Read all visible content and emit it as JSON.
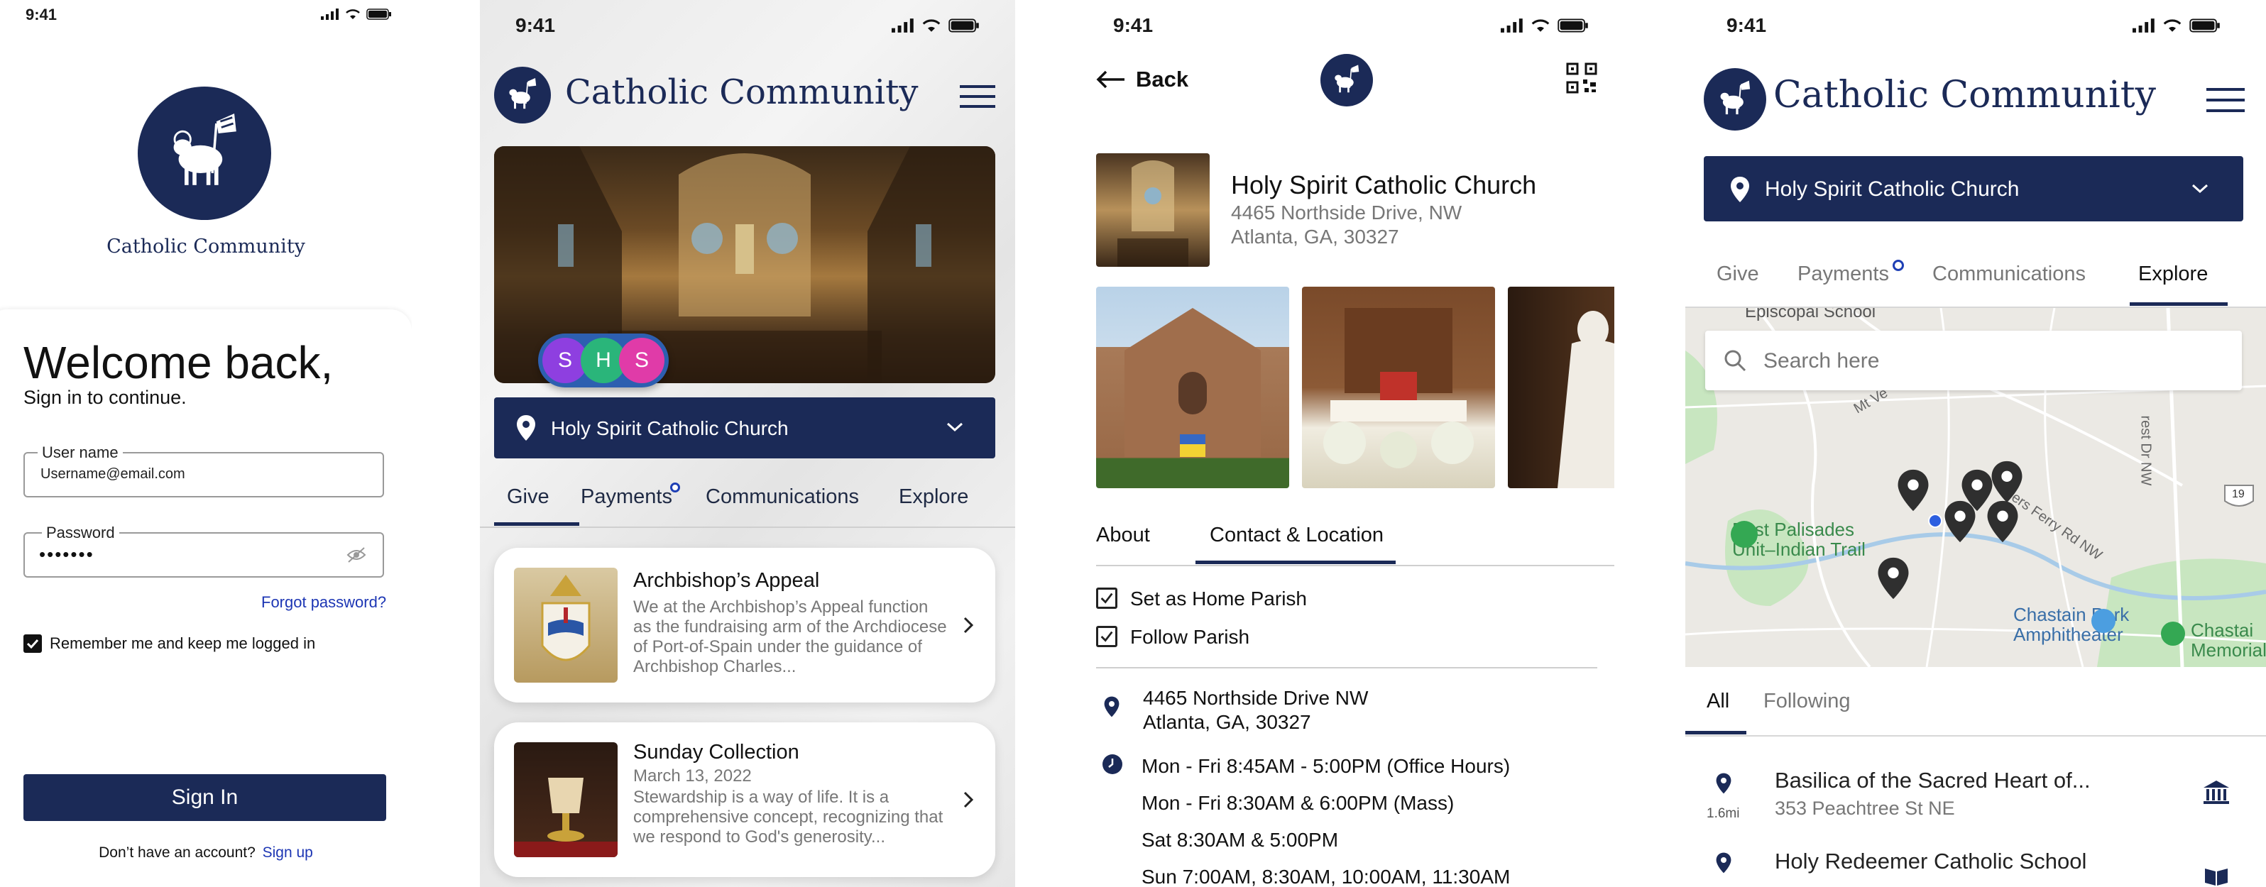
{
  "colors": {
    "navy": "#1b2a57",
    "accent_blue": "#1e3fb5",
    "link": "#1d36b4",
    "notification_dot": "#1e3fb5"
  },
  "status": {
    "time": "9:41"
  },
  "login": {
    "app_name": "Catholic Community",
    "welcome": "Welcome back,",
    "subtitle": "Sign in to continue.",
    "username_label": "User name",
    "username_value": "Username@email.com",
    "password_label": "Password",
    "password_value": "•••••••",
    "forgot": "Forgot password?",
    "remember": "Remember me and keep me logged in",
    "sign_in": "Sign In",
    "no_account": "Don’t have an account?",
    "sign_up": "Sign up"
  },
  "give": {
    "app_name": "Catholic Community",
    "avatars": [
      "S",
      "H",
      "S"
    ],
    "parish": "Holy Spirit Catholic Church",
    "tabs": [
      "Give",
      "Payments",
      "Communications",
      "Explore"
    ],
    "active_tab": "Give",
    "items": [
      {
        "title": "Archbishop’s Appeal",
        "date": "",
        "desc": "We at the Archbishop’s Appeal function as the fundraising arm of the Archdiocese of Port-of-Spain under the guidance of Archbishop Charles..."
      },
      {
        "title": "Sunday Collection",
        "date": "March 13, 2022",
        "desc": "Stewardship is a way of life. It is a comprehensive concept, recognizing that we respond to God's generosity..."
      }
    ]
  },
  "detail": {
    "back": "Back",
    "church_name": "Holy Spirit Catholic Church",
    "address_line1": "4465 Northside Drive, NW",
    "address_line2": "Atlanta, GA, 30327",
    "tabs": [
      "About",
      "Contact & Location"
    ],
    "active_tab": "Contact & Location",
    "checks": [
      "Set as Home Parish",
      "Follow Parish"
    ],
    "location_line1": "4465 Northside Drive NW",
    "location_line2": "Atlanta, GA, 30327",
    "hours": [
      "Mon - Fri 8:45AM - 5:00PM (Office Hours)",
      "Mon - Fri 8:30AM & 6:00PM (Mass)",
      "Sat 8:30AM & 5:00PM",
      "Sun 7:00AM, 8:30AM, 10:00AM, 11:30AM"
    ]
  },
  "explore": {
    "app_name": "Catholic Community",
    "parish": "Holy Spirit Catholic Church",
    "tabs": [
      "Give",
      "Payments",
      "Communications",
      "Explore"
    ],
    "active_tab": "Explore",
    "search_placeholder": "Search here",
    "map_labels": {
      "school": "Episcopal School",
      "palisades": "East Palisades\nUnit–Indian Trail",
      "chastain": "Chastain Park\nAmphitheater",
      "chastai": "Chastai\nMemorial",
      "road1": "Mt Ve",
      "road2": "rers Ferry Rd NW",
      "road3": "rest Dr NW",
      "shield": "19"
    },
    "filter_tabs": [
      "All",
      "Following"
    ],
    "active_filter": "All",
    "results": [
      {
        "name": "Basilica of the Sacred Heart of...",
        "address": "353 Peachtree St NE",
        "distance": "1.6mi",
        "icon": "bank-icon"
      },
      {
        "name": "Holy Redeemer Catholic School",
        "address": "",
        "distance": "",
        "icon": "book-icon"
      }
    ]
  }
}
